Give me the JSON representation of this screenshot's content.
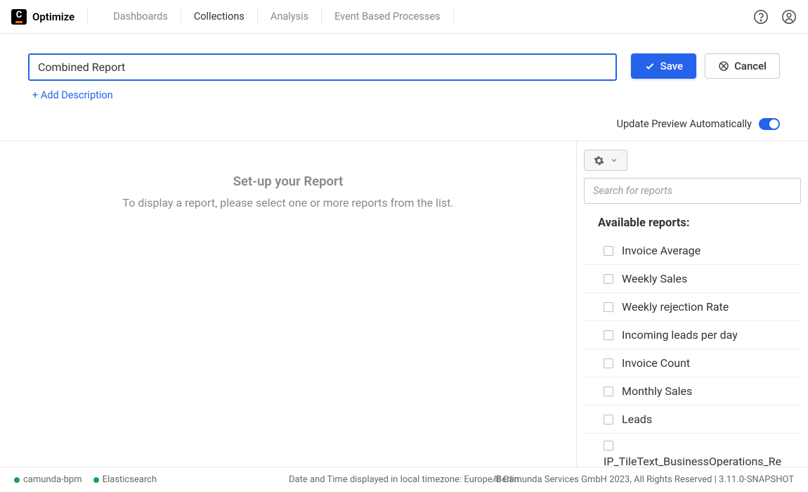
{
  "header": {
    "app_name": "Optimize",
    "nav": [
      {
        "label": "Dashboards",
        "active": false
      },
      {
        "label": "Collections",
        "active": true
      },
      {
        "label": "Analysis",
        "active": false
      },
      {
        "label": "Event Based Processes",
        "active": false
      }
    ]
  },
  "title_bar": {
    "name_value": "Combined Report",
    "add_description": "+ Add Description",
    "save_label": "Save",
    "cancel_label": "Cancel"
  },
  "preview": {
    "label": "Update Preview Automatically",
    "enabled": true
  },
  "main": {
    "heading": "Set-up your Report",
    "subheading": "To display a report, please select one or more reports from the list."
  },
  "sidebar": {
    "search_placeholder": "Search for reports",
    "available_label": "Available reports:",
    "reports": [
      "Invoice Average",
      "Weekly Sales",
      "Weekly rejection Rate",
      "Incoming leads per day",
      "Invoice Count",
      "Monthly Sales",
      "Leads",
      "IP_TileText_BusinessOperations_Re"
    ]
  },
  "footer": {
    "status": [
      {
        "label": "camunda-bpm",
        "ok": true
      },
      {
        "label": "Elasticsearch",
        "ok": true
      }
    ],
    "timezone": "Date and Time displayed in local timezone: Europe/Berlin",
    "copyright": "© Camunda Services GmbH 2023, All Rights Reserved | 3.11.0-SNAPSHOT"
  }
}
